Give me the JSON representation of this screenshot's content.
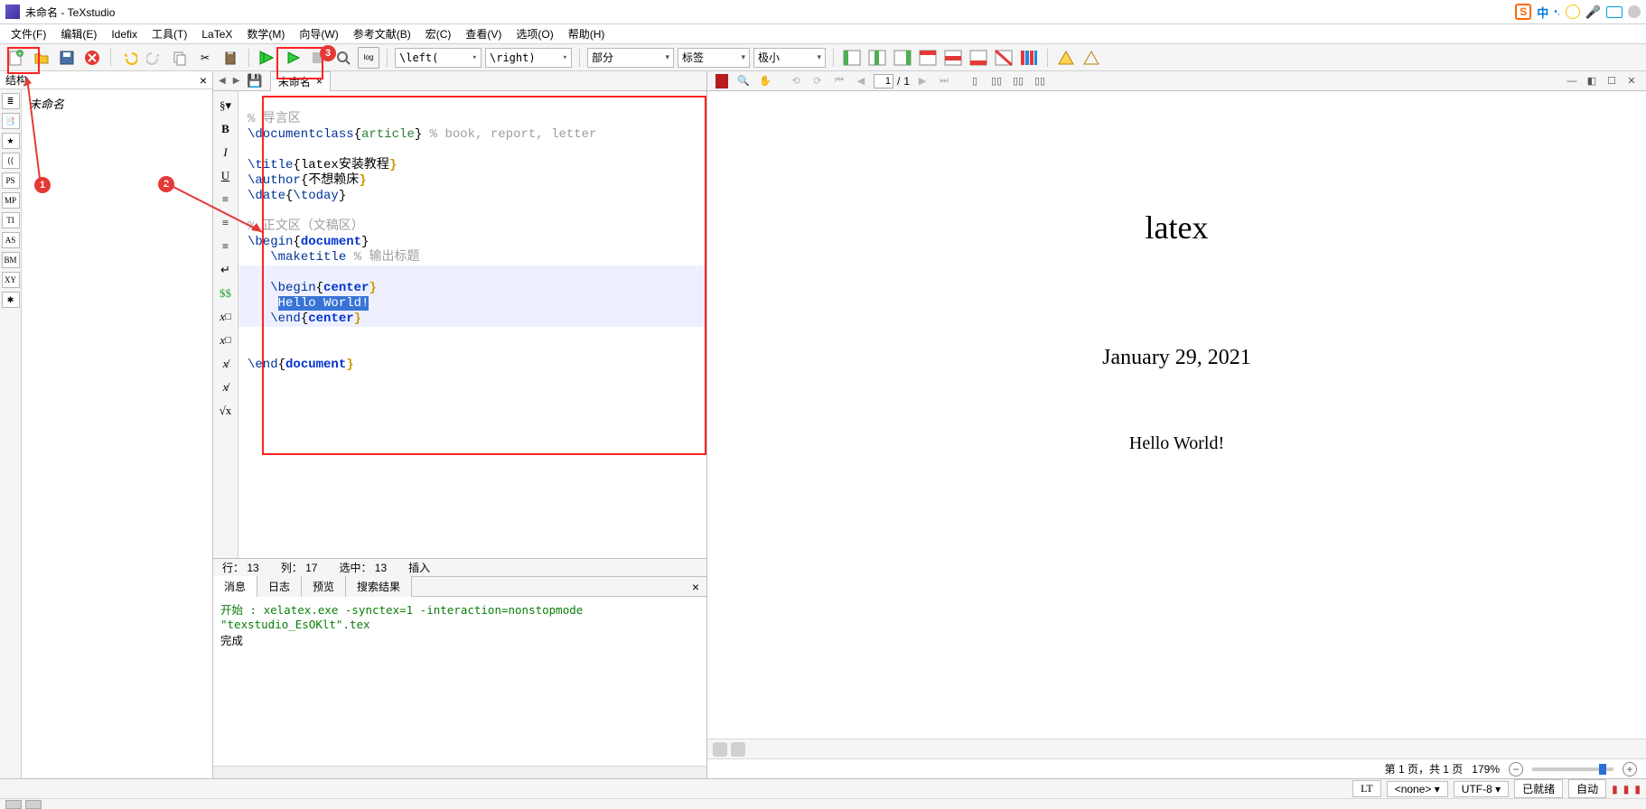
{
  "window": {
    "title": "未命名 - TeXstudio"
  },
  "menus": {
    "file": "文件(F)",
    "edit": "编辑(E)",
    "idefix": "Idefix",
    "tools": "工具(T)",
    "latex": "LaTeX",
    "math": "数学(M)",
    "wizard": "向导(W)",
    "bib": "参考文献(B)",
    "macro": "宏(C)",
    "view": "查看(V)",
    "options": "选项(O)",
    "help": "帮助(H)"
  },
  "toolbar": {
    "combo_left": "\\left(",
    "combo_right": "\\right)",
    "section": "部分",
    "label": "标签",
    "size": "极小"
  },
  "structure": {
    "title": "结构",
    "doc": "未命名"
  },
  "leftstrip": [
    "≣",
    "📑",
    "★",
    "⟨⟨",
    "PS",
    "MP",
    "TI",
    "AS",
    "BM",
    "XY",
    "✱"
  ],
  "editor": {
    "tab": "未命名",
    "status_row_label": "行：",
    "status_row": "13",
    "status_col_label": "列：",
    "status_col": "17",
    "status_sel_label": "选中：",
    "status_sel": "13",
    "status_mode": "插入",
    "code": {
      "l1_cmt": "% 导言区",
      "l2_cmd": "\\documentclass",
      "l2_arg": "article",
      "l2_cmt": " % book, report, letter",
      "l4_cmd": "\\title",
      "l4_txt": "latex安装教程",
      "l5_cmd": "\\author",
      "l5_txt": "不想赖床",
      "l6_cmd": "\\date",
      "l6_cmd2": "\\today",
      "l8_cmt": "% 正文区（文稿区）",
      "l9_cmd": "\\begin",
      "l9_env": "document",
      "l10_cmd": "\\maketitle",
      "l10_cmt": " % 输出标题",
      "l12_cmd": "\\begin",
      "l12_env": "center",
      "l13_sel": "Hello World!",
      "l14_cmd": "\\end",
      "l14_env": "center",
      "l17_cmd": "\\end",
      "l17_env": "document"
    }
  },
  "log": {
    "tabs": {
      "msg": "消息",
      "journal": "日志",
      "preview": "预览",
      "search": "搜索结果"
    },
    "line1_label": "开始 : ",
    "line1": "xelatex.exe -synctex=1 -interaction=nonstopmode \"texstudio_EsOKlt\".tex",
    "line2": "完成"
  },
  "preview": {
    "title": "latex",
    "date": "January 29, 2021",
    "hello": "Hello World!",
    "page_current": "1",
    "page_total": "1",
    "pageinfo": "第 1 页，共 1 页",
    "zoom": "179%"
  },
  "status": {
    "lt": "LT",
    "none": "<none>",
    "encoding": "UTF-8",
    "ready": "已就绪",
    "auto": "自动"
  },
  "annotations": {
    "b1": "1",
    "b2": "2",
    "b3": "3"
  },
  "tray": {
    "sogou": "S",
    "cn": "中"
  }
}
